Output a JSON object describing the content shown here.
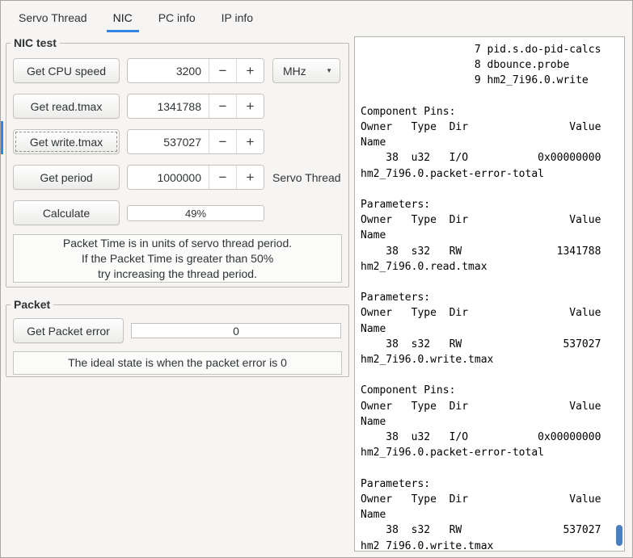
{
  "colors": {
    "accent": "#3584e4"
  },
  "tabs": {
    "items": [
      {
        "label": "Servo Thread"
      },
      {
        "label": "NIC"
      },
      {
        "label": "PC info"
      },
      {
        "label": "IP info"
      }
    ],
    "active": "NIC"
  },
  "icons": {
    "minus": "−",
    "plus": "+",
    "dropdown_arrow": "▼"
  },
  "nic_test": {
    "frame_label": "NIC test",
    "cpu": {
      "button": "Get CPU speed",
      "value": "3200",
      "unit": "MHz"
    },
    "read": {
      "button": "Get read.tmax",
      "value": "1341788"
    },
    "write": {
      "button": "Get write.tmax",
      "value": "537027"
    },
    "period": {
      "button": "Get period",
      "value": "1000000",
      "caption": "Servo Thread"
    },
    "calculate": {
      "button": "Calculate",
      "progress_text": "49%"
    },
    "note": {
      "line1": "Packet Time is in units of servo thread period.",
      "line2": "If the Packet Time is greater than 50%",
      "line3": "try increasing the thread period."
    }
  },
  "packet": {
    "frame_label": "Packet",
    "button": "Get Packet error",
    "value": "0",
    "note": "The ideal state is when the packet error is 0"
  },
  "hal_output": {
    "lines": [
      "                  7 pid.s.do-pid-calcs",
      "                  8 dbounce.probe",
      "                  9 hm2_7i96.0.write",
      "",
      "Component Pins:",
      "Owner   Type  Dir                Value",
      "Name",
      "    38  u32   I/O           0x00000000",
      "hm2_7i96.0.packet-error-total",
      "",
      "Parameters:",
      "Owner   Type  Dir                Value",
      "Name",
      "    38  s32   RW               1341788",
      "hm2_7i96.0.read.tmax",
      "",
      "Parameters:",
      "Owner   Type  Dir                Value",
      "Name",
      "    38  s32   RW                537027",
      "hm2_7i96.0.write.tmax",
      "",
      "Component Pins:",
      "Owner   Type  Dir                Value",
      "Name",
      "    38  u32   I/O           0x00000000",
      "hm2_7i96.0.packet-error-total",
      "",
      "Parameters:",
      "Owner   Type  Dir                Value",
      "Name",
      "    38  s32   RW                537027",
      "hm2_7i96.0.write.tmax"
    ]
  }
}
